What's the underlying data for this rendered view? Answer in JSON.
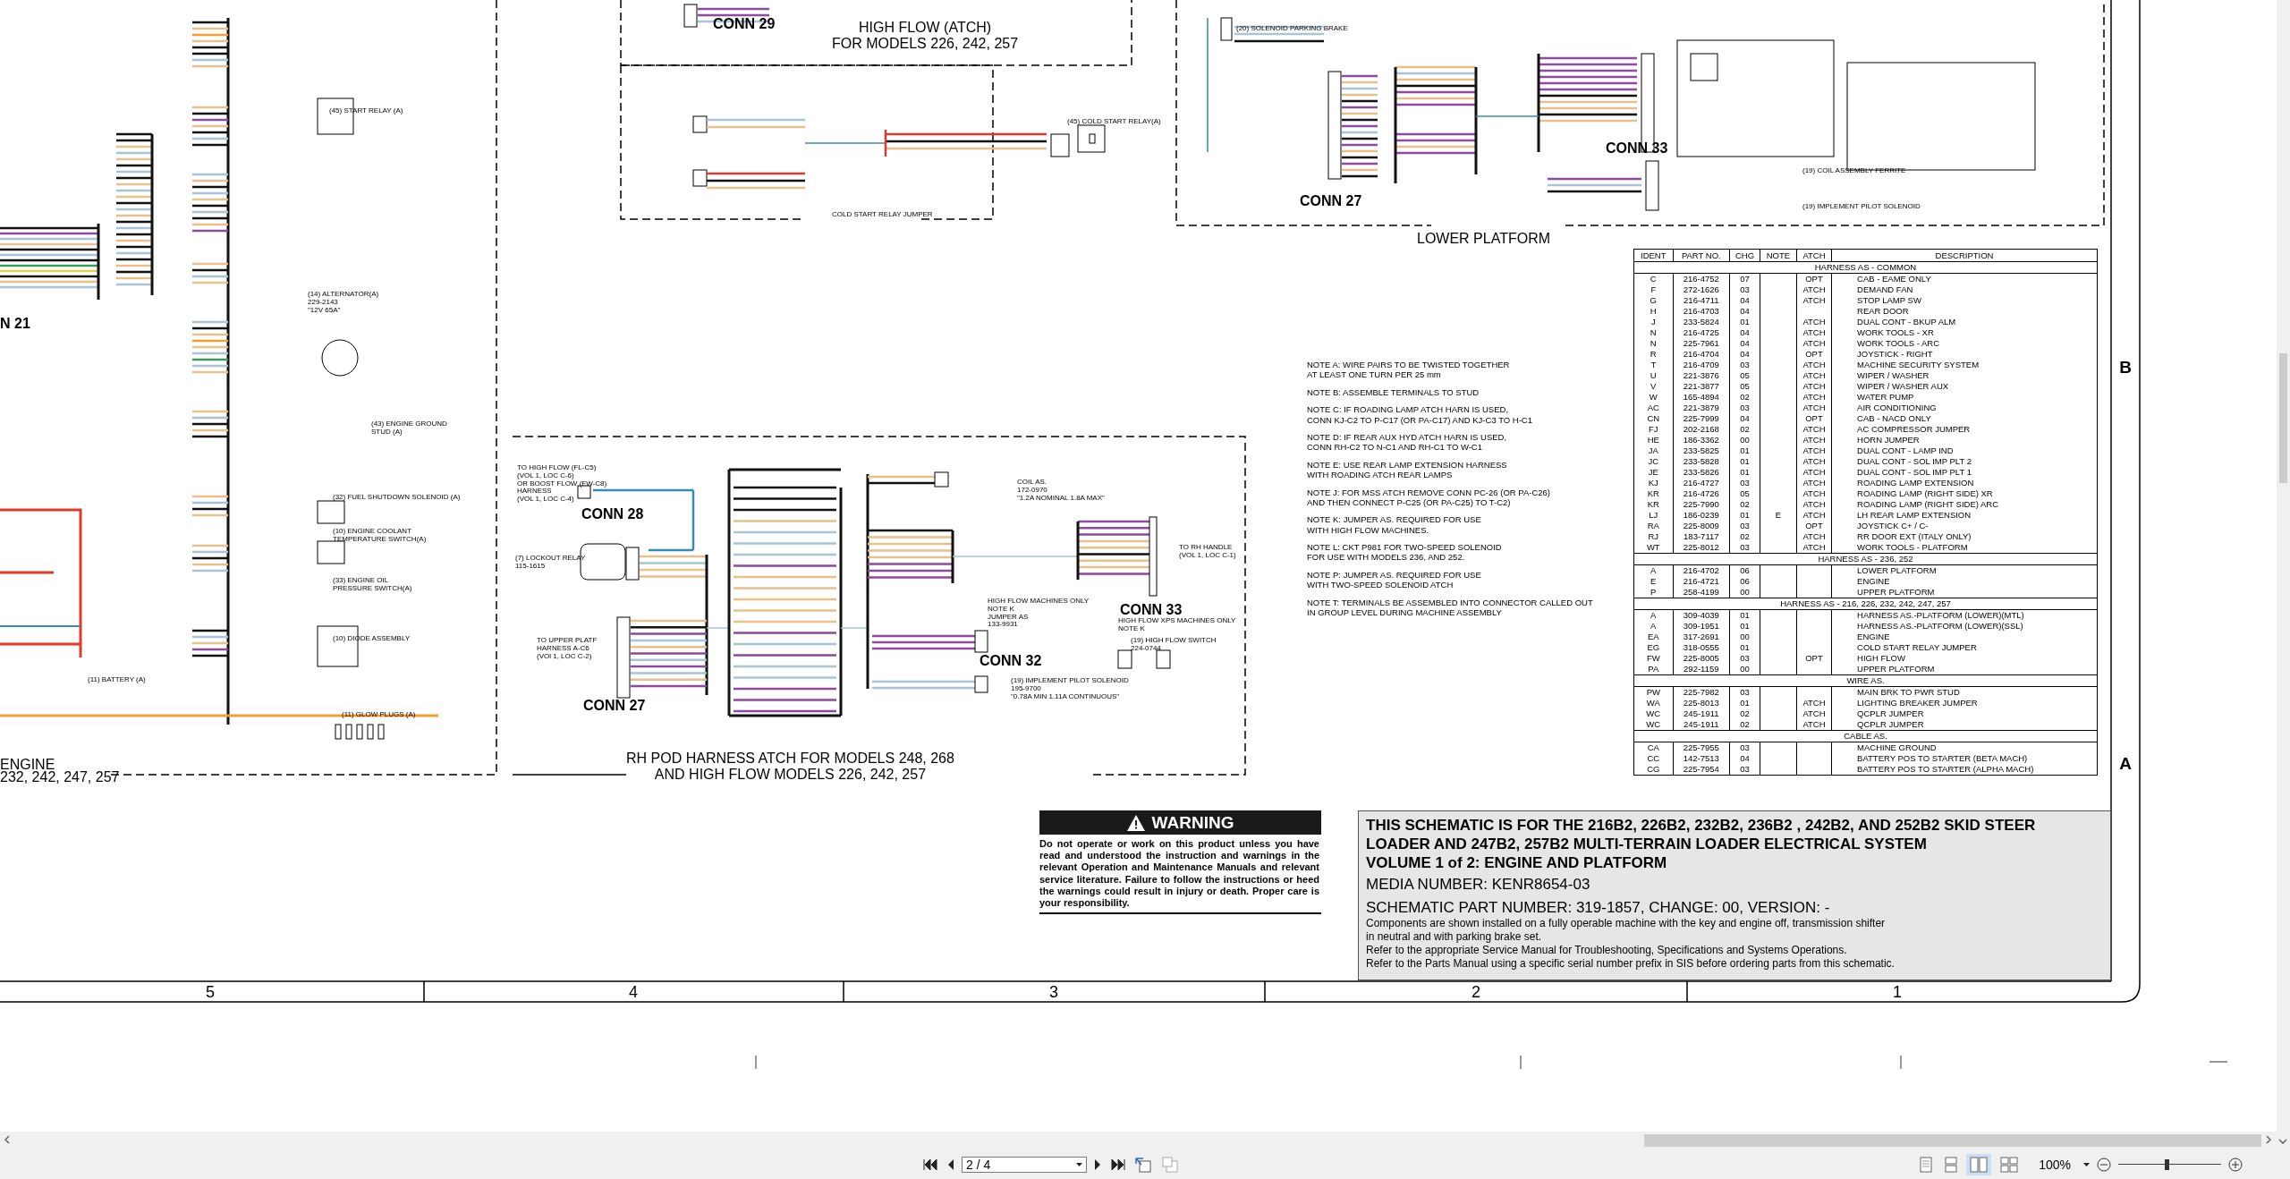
{
  "schematic": {
    "labels": [
      {
        "kind": "comp",
        "lines": [
          "(45) START RELAY (A)"
        ]
      },
      {
        "kind": "comp",
        "lines": [
          "(14) ALTERNATOR(A)",
          "229-2143",
          "\"12V 65A\""
        ]
      },
      {
        "kind": "conn",
        "lines": [
          "N 21"
        ]
      },
      {
        "kind": "comp",
        "lines": [
          "(43) ENGINE GROUND",
          "STUD (A)"
        ]
      },
      {
        "kind": "comp",
        "lines": [
          "(32) FUEL SHUTDOWN SOLENOID (A)"
        ]
      },
      {
        "kind": "comp",
        "lines": [
          "(10) ENGINE COOLANT",
          "TEMPERATURE SWITCH(A)"
        ]
      },
      {
        "kind": "comp",
        "lines": [
          "(33) ENGINE OIL",
          "PRESSURE SWITCH(A)"
        ]
      },
      {
        "kind": "comp",
        "lines": [
          "(10) DIODE ASSEMBLY"
        ]
      },
      {
        "kind": "comp",
        "lines": [
          "(11) BATTERY (A)"
        ]
      },
      {
        "kind": "comp",
        "lines": [
          "(11) GLOW PLUGS (A)"
        ]
      },
      {
        "kind": "title",
        "lines": [
          "ENGINE"
        ]
      },
      {
        "kind": "title",
        "lines": [
          "232, 242, 247, 257"
        ]
      },
      {
        "kind": "conn",
        "lines": [
          "CONN 29"
        ]
      },
      {
        "kind": "title",
        "lines": [
          "HIGH FLOW (ATCH)",
          "FOR MODELS 226, 242, 257"
        ]
      },
      {
        "kind": "comp",
        "lines": [
          "(45) COLD START RELAY(A)"
        ]
      },
      {
        "kind": "comp",
        "lines": [
          "COLD START RELAY JUMPER"
        ]
      },
      {
        "kind": "comp",
        "lines": [
          "(20) SOLENOID PARKING BRAKE"
        ]
      },
      {
        "kind": "conn",
        "lines": [
          "CONN 27"
        ]
      },
      {
        "kind": "conn",
        "lines": [
          "CONN 33"
        ]
      },
      {
        "kind": "comp",
        "lines": [
          "(19) COIL ASSEMBLY FERRITE"
        ]
      },
      {
        "kind": "comp",
        "lines": [
          "(19) IMPLEMENT PILOT SOLENOID"
        ]
      },
      {
        "kind": "title",
        "lines": [
          "LOWER PLATFORM"
        ]
      },
      {
        "kind": "comp",
        "lines": [
          "TO HIGH FLOW (FL-C5)",
          "(VOL 1, LOC C-6)",
          "OR BOOST FLOW (FW-C8)",
          "HARNESS",
          "(VOL 1, LOC C-4)"
        ]
      },
      {
        "kind": "conn",
        "lines": [
          "CONN 28"
        ]
      },
      {
        "kind": "comp",
        "lines": [
          "(7) LOCKOUT RELAY",
          "115-1615"
        ]
      },
      {
        "kind": "comp",
        "lines": [
          "TO UPPER PLATF",
          "HARNESS A-C6",
          "(VOl 1, LOC C-2)"
        ]
      },
      {
        "kind": "conn",
        "lines": [
          "CONN 27"
        ]
      },
      {
        "kind": "comp",
        "lines": [
          "COIL AS.",
          "172-0970",
          "\"1.2A NOMINAL 1.8A MAX\""
        ]
      },
      {
        "kind": "comp",
        "lines": [
          "TO RH HANDLE",
          "(VOL 1, LOC C-1)"
        ]
      },
      {
        "kind": "conn",
        "lines": [
          "CONN 33"
        ]
      },
      {
        "kind": "comp",
        "lines": [
          "HIGH FLOW MACHINES ONLY",
          "NOTE K",
          "JUMPER AS",
          "133-9931"
        ]
      },
      {
        "kind": "conn",
        "lines": [
          "CONN 32"
        ]
      },
      {
        "kind": "comp",
        "lines": [
          "HIGH FLOW XPS MACHINES ONLY",
          "NOTE K"
        ]
      },
      {
        "kind": "comp",
        "lines": [
          "(19) HIGH FLOW SWITCH",
          "224-0744"
        ]
      },
      {
        "kind": "comp",
        "lines": [
          "(19) IMPLEMENT PILOT SOLENOID",
          "195-9700",
          "\"0.78A MIN 1.11A CONTINUOUS\""
        ]
      },
      {
        "kind": "title",
        "lines": [
          "RH POD HARNESS ATCH FOR MODELS 248, 268",
          "AND HIGH FLOW MODELS 226, 242, 257"
        ]
      }
    ],
    "notes": [
      [
        "NOTE A:  WIRE PAIRS TO BE TWISTED TOGETHER",
        "AT LEAST ONE TURN PER 25 mm"
      ],
      [
        "NOTE B:  ASSEMBLE TERMINALS TO STUD"
      ],
      [
        "NOTE C:  IF ROADING LAMP ATCH HARN IS USED,",
        "CONN KJ-C2 TO P-C17 (OR PA-C17) AND KJ-C3 TO H-C1"
      ],
      [
        "NOTE D:  IF REAR AUX HYD ATCH HARN IS USED,",
        "CONN RH-C2 TO N-C1 AND RH-C1 TO W-C1"
      ],
      [
        "NOTE E: USE REAR LAMP EXTENSION HARNESS",
        "WITH ROADING ATCH REAR LAMPS"
      ],
      [
        "NOTE J: FOR MSS ATCH REMOVE CONN PC-26 (OR PA-C26)",
        "AND THEN CONNECT P-C25 (OR PA-C25) TO T-C2)"
      ],
      [
        "NOTE K: JUMPER AS. REQUIRED FOR USE",
        "WITH HIGH FLOW MACHINES."
      ],
      [
        "NOTE L: CKT P981 FOR TWO-SPEED SOLENOID",
        "FOR USE WITH MODELS 236, AND 252."
      ],
      [
        "NOTE P: JUMPER AS. REQUIRED FOR USE",
        "WITH TWO-SPEED SOLENOID ATCH"
      ],
      [
        "NOTE T: TERMINALS BE ASSEMBLED INTO CONNECTOR CALLED OUT",
        "IN GROUP LEVEL DURING  MACHINE ASSEMBLY"
      ]
    ],
    "parts_table": {
      "columns": [
        "IDENT",
        "PART NO.",
        "CHG",
        "NOTE",
        "ATCH",
        "DESCRIPTION"
      ],
      "sections": [
        {
          "title": "HARNESS AS - COMMON",
          "rows": [
            [
              "C",
              "216-4752",
              "07",
              "",
              "OPT",
              "CAB - EAME ONLY"
            ],
            [
              "F",
              "272-1626",
              "03",
              "",
              "ATCH",
              "DEMAND FAN"
            ],
            [
              "G",
              "216-4711",
              "04",
              "",
              "ATCH",
              "STOP LAMP SW"
            ],
            [
              "H",
              "216-4703",
              "04",
              "",
              "",
              "REAR DOOR"
            ],
            [
              "J",
              "233-5824",
              "01",
              "",
              "ATCH",
              "DUAL CONT - BKUP ALM"
            ],
            [
              "N",
              "216-4725",
              "04",
              "",
              "ATCH",
              "WORK TOOLS - XR"
            ],
            [
              "N",
              "225-7961",
              "04",
              "",
              "ATCH",
              "WORK TOOLS - ARC"
            ],
            [
              "R",
              "216-4704",
              "04",
              "",
              "OPT",
              "JOYSTICK - RIGHT"
            ],
            [
              "T",
              "216-4709",
              "03",
              "",
              "ATCH",
              "MACHINE SECURITY SYSTEM"
            ],
            [
              "U",
              "221-3876",
              "05",
              "",
              "ATCH",
              "WIPER / WASHER"
            ],
            [
              "V",
              "221-3877",
              "05",
              "",
              "ATCH",
              "WIPER / WASHER AUX"
            ],
            [
              "W",
              "165-4894",
              "02",
              "",
              "ATCH",
              "WATER PUMP"
            ],
            [
              "AC",
              "221-3879",
              "03",
              "",
              "ATCH",
              "AIR CONDITIONING"
            ],
            [
              "CN",
              "225-7999",
              "04",
              "",
              "OPT",
              "CAB - NACD ONLY"
            ],
            [
              "FJ",
              "202-2168",
              "02",
              "",
              "ATCH",
              "AC COMPRESSOR JUMPER"
            ],
            [
              "HE",
              "186-3362",
              "00",
              "",
              "ATCH",
              "HORN JUMPER"
            ],
            [
              "JA",
              "233-5825",
              "01",
              "",
              "ATCH",
              "DUAL CONT - LAMP IND"
            ],
            [
              "JC",
              "233-5828",
              "01",
              "",
              "ATCH",
              "DUAL CONT - SOL IMP PLT 2"
            ],
            [
              "JE",
              "233-5826",
              "01",
              "",
              "ATCH",
              "DUAL CONT - SOL IMP PLT 1"
            ],
            [
              "KJ",
              "216-4727",
              "03",
              "",
              "ATCH",
              "ROADING LAMP EXTENSION"
            ],
            [
              "KR",
              "216-4726",
              "05",
              "",
              "ATCH",
              "ROADING LAMP (RIGHT SIDE) XR"
            ],
            [
              "KR",
              "225-7990",
              "02",
              "",
              "ATCH",
              "ROADING LAMP (RIGHT SIDE) ARC"
            ],
            [
              "LJ",
              "186-0239",
              "01",
              "E",
              "ATCH",
              "LH REAR LAMP EXTENSION"
            ],
            [
              "RA",
              "225-8009",
              "03",
              "",
              "OPT",
              "JOYSTICK C+ / C-"
            ],
            [
              "RJ",
              "183-7117",
              "02",
              "",
              "ATCH",
              "RR DOOR EXT (ITALY ONLY)"
            ],
            [
              "WT",
              "225-8012",
              "03",
              "",
              "ATCH",
              "WORK TOOLS - PLATFORM"
            ]
          ]
        },
        {
          "title": "HARNESS AS - 236, 252",
          "rows": [
            [
              "A",
              "216-4702",
              "06",
              "",
              "",
              "LOWER PLATFORM"
            ],
            [
              "E",
              "216-4721",
              "06",
              "",
              "",
              "ENGINE"
            ],
            [
              "P",
              "258-4199",
              "00",
              "",
              "",
              "UPPER PLATFORM"
            ]
          ]
        },
        {
          "title": "HARNESS AS - 216, 226, 232, 242, 247, 257",
          "rows": [
            [
              "A",
              "309-4039",
              "01",
              "",
              "",
              "HARNESS AS.-PLATFORM (LOWER)(MTL)"
            ],
            [
              "A",
              "309-1951",
              "01",
              "",
              "",
              "HARNESS AS.-PLATFORM (LOWER)(SSL)"
            ],
            [
              "EA",
              "317-2691",
              "00",
              "",
              "",
              "ENGINE"
            ],
            [
              "EG",
              "318-0555",
              "01",
              "",
              "",
              "COLD START RELAY JUMPER"
            ],
            [
              "FW",
              "225-8005",
              "03",
              "",
              "OPT",
              "HIGH FLOW"
            ],
            [
              "PA",
              "292-1159",
              "00",
              "",
              "",
              "UPPER PLATFORM"
            ]
          ]
        },
        {
          "title": "WIRE AS.",
          "rows": [
            [
              "PW",
              "225-7982",
              "03",
              "",
              "",
              "MAIN BRK TO PWR STUD"
            ],
            [
              "WA",
              "225-8013",
              "01",
              "",
              "ATCH",
              "LIGHTING BREAKER JUMPER"
            ],
            [
              "WC",
              "245-1911",
              "02",
              "",
              "ATCH",
              "QCPLR JUMPER"
            ],
            [
              "WC",
              "245-1911",
              "02",
              "",
              "ATCH",
              "QCPLR JUMPER"
            ]
          ]
        },
        {
          "title": "CABLE AS.",
          "rows": [
            [
              "CA",
              "225-7955",
              "03",
              "",
              "",
              "MACHINE GROUND"
            ],
            [
              "CC",
              "142-7513",
              "04",
              "",
              "",
              "BATTERY POS TO STARTER (BETA MACH)"
            ],
            [
              "CG",
              "225-7954",
              "03",
              "",
              "",
              "BATTERY POS TO STARTER (ALPHA MACH)"
            ]
          ]
        }
      ]
    },
    "warning": {
      "title": "WARNING",
      "text": "Do not operate or work on this product unless you have read and understood the instruction and warnings in the relevant Operation and Maintenance Manuals and relevant service literature. Failure to follow the instructions or heed the warnings could result in injury or death. Proper care is your responsibility."
    },
    "title_block": {
      "title_lines": [
        "THIS SCHEMATIC IS FOR THE 216B2, 226B2, 232B2, 236B2 , 242B2, AND 252B2 SKID STEER",
        "LOADER AND 247B2, 257B2 MULTI-TERRAIN LOADER ELECTRICAL SYSTEM",
        "VOLUME 1 of 2: ENGINE AND PLATFORM"
      ],
      "media_number": "MEDIA NUMBER: KENR8654-03",
      "part_number": "SCHEMATIC PART NUMBER: 319-1857, CHANGE: 00, VERSION: -",
      "remarks": [
        "Components are shown installed on a fully operable machine with the key and engine off, transmission shifter",
        "in neutral and with parking brake set.",
        "Refer to the appropriate Service Manual for Troubleshooting, Specifications and Systems Operations.",
        "Refer to the Parts Manual using a specific serial number prefix in SIS before ordering parts from this schematic."
      ]
    },
    "zone_numbers": [
      "5",
      "4",
      "3",
      "2",
      "1"
    ],
    "zone_letters": [
      "B",
      "A"
    ]
  },
  "viewer": {
    "page_field": "2 / 4",
    "zoom": "100%",
    "zoom_slider": {
      "level": 0.47
    },
    "view_modes": [
      {
        "selected": false
      },
      {
        "selected": false
      },
      {
        "selected": true
      },
      {
        "selected": false
      }
    ]
  }
}
